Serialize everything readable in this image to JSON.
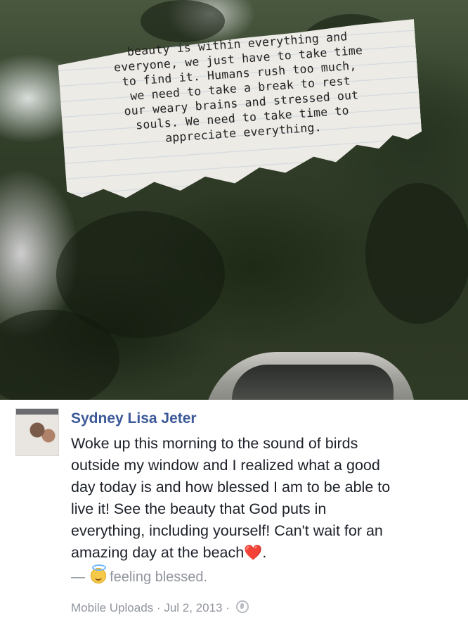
{
  "photo": {
    "note_lines": [
      "beauty is within everything and",
      "everyone, we just have to take time",
      "to find it. Humans rush too much,",
      "we need to take a break to rest",
      "our weary brains and stressed out",
      "souls. We need to take time to",
      "appreciate everything."
    ]
  },
  "post": {
    "author": "Sydney Lisa Jeter",
    "body_lines": [
      "Woke up this morning to the sound of birds",
      "outside my window and I realized what a good",
      "day today is and how blessed I am to be able to",
      "live it! See the beauty that God puts in",
      "everything, including yourself! Can't wait for an",
      "amazing day at the beach"
    ],
    "body_end_emoji": "❤️",
    "body_end_punct": ".",
    "feeling_dash": "—",
    "feeling_icon": "smiling-face-with-halo",
    "feeling_text": "feeling blessed.",
    "album": "Mobile Uploads",
    "separator": "·",
    "date": "Jul 2, 2013",
    "audience_icon": "globe"
  },
  "colors": {
    "author_link": "#3b5998",
    "body_text": "#1d2129",
    "meta_text": "#90949c",
    "heart": "#e8405c"
  }
}
